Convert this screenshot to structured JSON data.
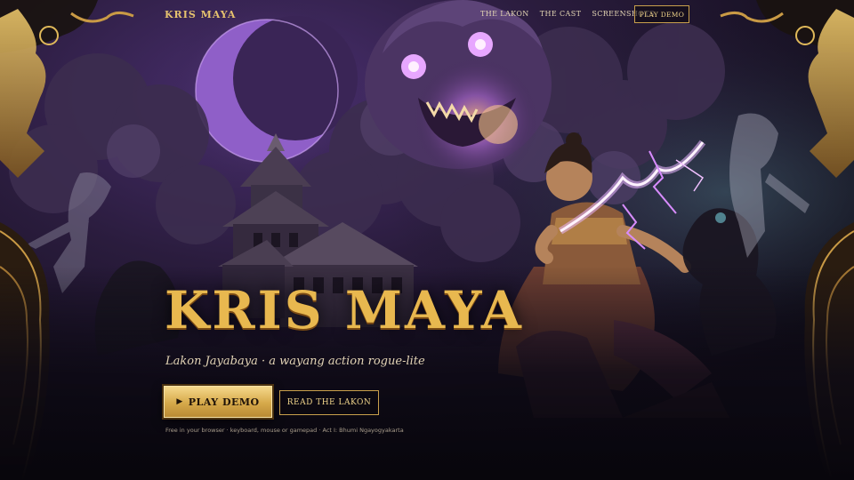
{
  "nav": {
    "brand": "KRIS MAYA",
    "links": [
      "THE LAKON",
      "THE CAST",
      "SCREENSHOTS"
    ],
    "cta": "PLAY DEMO"
  },
  "hero": {
    "title": "KRIS MAYA",
    "subtitle": "Lakon Jayabaya · a wayang action rogue-lite",
    "primary_button": "PLAY DEMO",
    "primary_icon": "play-icon",
    "secondary_button": "READ THE LAKON",
    "footnote": "Free in your browser · keyboard, mouse or gamepad · Act I: Bhumi Ngayogyakarta"
  },
  "colors": {
    "gold": "#d9b15a",
    "purple": "#6a3f9c",
    "bg": "#0d0a14"
  }
}
